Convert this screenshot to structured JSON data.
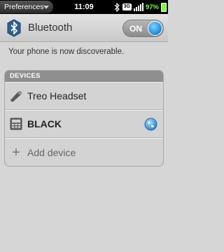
{
  "status_bar": {
    "app_menu_label": "Preferences",
    "time": "11:09",
    "network": "3G",
    "battery_percent": "97%",
    "icons": [
      "bluetooth-icon",
      "signal-strength-icon",
      "battery-icon"
    ]
  },
  "header": {
    "title": "Bluetooth",
    "icon": "bluetooth-icon",
    "toggle_label": "ON"
  },
  "message": "Your phone is now discoverable.",
  "devices": {
    "header": "DEVICES",
    "items": [
      {
        "label": "Treo Headset",
        "icon": "headset-icon",
        "bold": false
      },
      {
        "label": "BLACK",
        "icon": "computer-icon",
        "bold": true,
        "status_icon": "globe-icon"
      }
    ],
    "add_label": "Add device"
  },
  "colors": {
    "accent": "#1d86d9",
    "battery": "#7cff3a"
  }
}
